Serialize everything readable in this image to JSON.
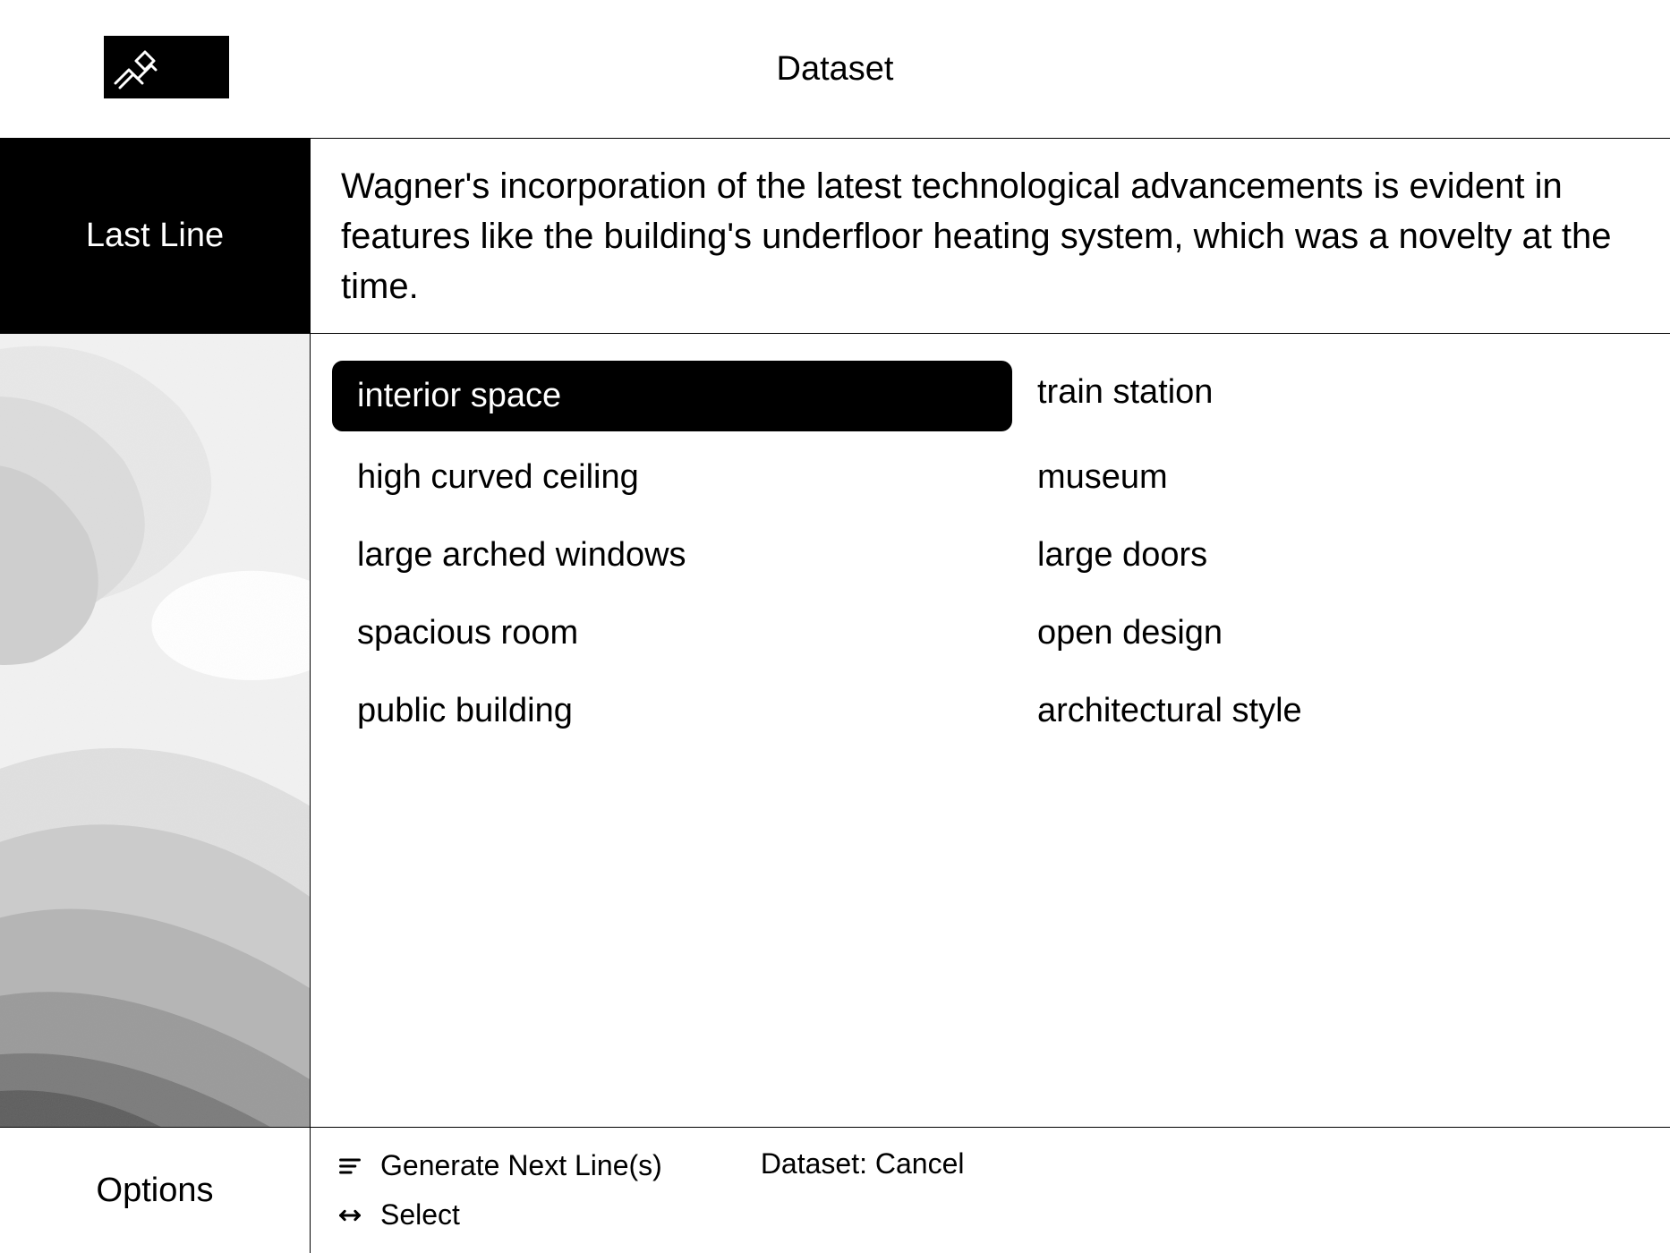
{
  "header": {
    "title": "Dataset"
  },
  "sidebar": {
    "last_line_label": "Last Line",
    "options_label": "Options"
  },
  "last_line_text": "Wagner's incorporation of the latest technological advancements is evident in features like the building's underfloor heating system, which was a novelty at the time.",
  "options": {
    "col1": [
      {
        "label": "interior space",
        "selected": true
      },
      {
        "label": "high curved ceiling",
        "selected": false
      },
      {
        "label": "large arched windows",
        "selected": false
      },
      {
        "label": "spacious room",
        "selected": false
      },
      {
        "label": "public building",
        "selected": false
      }
    ],
    "col2": [
      {
        "label": "train station",
        "selected": false
      },
      {
        "label": "museum",
        "selected": false
      },
      {
        "label": "large doors",
        "selected": false
      },
      {
        "label": "open design",
        "selected": false
      },
      {
        "label": "architectural style",
        "selected": false
      }
    ]
  },
  "footer": {
    "generate_label": "Generate Next Line(s)",
    "select_label": "Select",
    "cancel_label": "Dataset: Cancel"
  }
}
